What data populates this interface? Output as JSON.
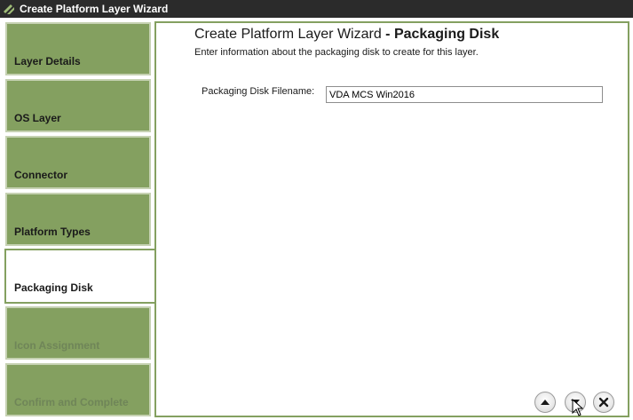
{
  "window": {
    "title": "Create Platform Layer Wizard",
    "app_icon": "platform-layers-icon"
  },
  "sidebar": {
    "steps": [
      {
        "label": "Layer Details",
        "state": "completed"
      },
      {
        "label": "OS Layer",
        "state": "completed"
      },
      {
        "label": "Connector",
        "state": "completed"
      },
      {
        "label": "Platform Types",
        "state": "completed"
      },
      {
        "label": "Packaging Disk",
        "state": "active"
      },
      {
        "label": "Icon Assignment",
        "state": "disabled"
      },
      {
        "label": "Confirm and Complete",
        "state": "disabled"
      }
    ]
  },
  "main": {
    "heading_prefix": "Create Platform Layer Wizard",
    "heading_separator": " - ",
    "heading_step": "Packaging Disk",
    "subtitle": "Enter information about the packaging disk to create for this layer.",
    "fields": {
      "packaging_disk": {
        "label": "Packaging Disk Filename:",
        "value": "VDA MCS Win2016"
      }
    }
  },
  "footer": {
    "buttons": [
      {
        "name": "previous-button",
        "icon": "arrow-up-icon"
      },
      {
        "name": "next-button",
        "icon": "arrow-down-icon"
      },
      {
        "name": "cancel-button",
        "icon": "close-icon"
      }
    ]
  },
  "colors": {
    "accent": "#84a060",
    "titlebar": "#2b2b2b",
    "step_disabled_text": "#6f8558"
  }
}
